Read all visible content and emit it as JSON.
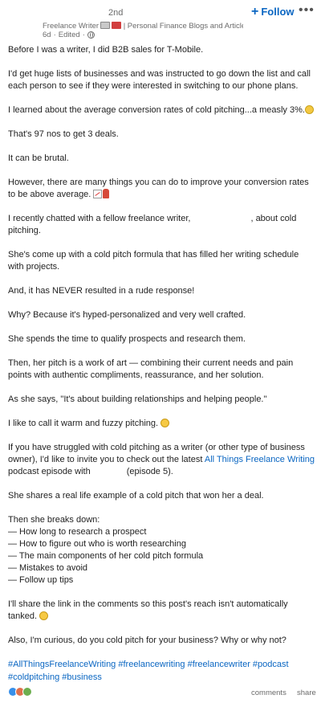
{
  "header": {
    "degree": "2nd",
    "author_role": "Freelance Writer",
    "author_headline": "| Personal Finance Blogs and Articles...",
    "time": "6d",
    "edited": "Edited",
    "follow_label": "Follow",
    "follow_plus": "+",
    "more_label": "•••"
  },
  "body": {
    "p1": "Before I was a writer, I did B2B sales for T-Mobile.",
    "p2": "I'd get huge lists of businesses and was instructed to go down the list and call each person to see if they were interested in switching to our phone plans.",
    "p3": "I learned about the average conversion rates of cold pitching...a measly 3%.",
    "p4": "That's 97 nos to get 3 deals.",
    "p5": "It can be brutal.",
    "p6": "However, there are many things you can do to improve your conversion rates to be above average.",
    "p7a": "I recently chatted with a fellow freelance writer,",
    "p7b": ", about cold pitching.",
    "p8": "She's come up with a cold pitch formula that has filled her writing schedule with projects.",
    "p9": "And, it has NEVER resulted in a rude response!",
    "p10": "Why? Because it's hyped-personalized and very well crafted.",
    "p11": "She spends the time to qualify prospects and research them.",
    "p12": "Then, her pitch is a work of art — combining their current needs and pain points with authentic compliments, reassurance, and her solution.",
    "p13": "As she says, \"It's about building relationships and helping people.\"",
    "p14": "I like to call it warm and fuzzy pitching.",
    "p15a": "If you have struggled with cold pitching as a writer (or other type of business owner), I'd like to invite you to check out the latest",
    "p15_link": "All Things Freelance Writing",
    "p15b": "podcast episode with",
    "p15c": "(episode 5).",
    "p16": "She shares a real life example of a cold pitch that won her a deal.",
    "p17_intro": "Then she breaks down:",
    "list": [
      "— How long to research a prospect",
      "— How to figure out who is worth researching",
      "— The main components of her cold pitch formula",
      "— Mistakes to avoid",
      "— Follow up tips"
    ],
    "p18": "I'll share the link in the comments so this post's reach isn't automatically tanked.",
    "p19": "Also, I'm curious, do you cold pitch for your business? Why or why not?"
  },
  "hashtags": {
    "h1": "#AllThingsFreelanceWriting",
    "h2": "#freelancewriting",
    "h3": "#freelancewriter",
    "h4": "#podcast",
    "h5": "#coldpitching",
    "h6": "#business"
  },
  "footer": {
    "comments_label": "comments",
    "share_label": "share"
  },
  "icons": {
    "sad": "weary-face-emoji",
    "chart": "chart-emoji",
    "person": "person-emoji",
    "smile": "smiling-face-emoji",
    "sweat": "grinning-sweat-emoji"
  }
}
